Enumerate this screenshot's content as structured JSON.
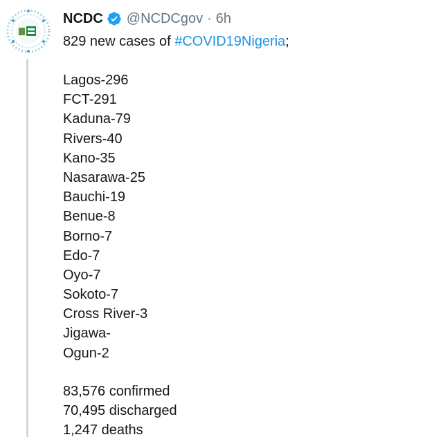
{
  "account": {
    "display_name": "NCDC",
    "handle": "@NCDCgov",
    "separator": "·",
    "time": "6h",
    "verified": true
  },
  "tweet": {
    "intro_text": "829 new cases of ",
    "hashtag": "#COVID19Nigeria",
    "intro_suffix": ";",
    "states": [
      "Lagos-296",
      "FCT-291",
      "Kaduna-79",
      "Rivers-40",
      "Kano-35",
      "Nasarawa-25",
      "Bauchi-19",
      "Benue-8",
      "Borno-7",
      "Edo-7",
      "Oyo-7",
      "Sokoto-7",
      "Cross River-3",
      "Jigawa-",
      "Ogun-2"
    ],
    "totals": [
      "83,576 confirmed",
      "70,495 discharged",
      "1,247 deaths"
    ]
  },
  "colors": {
    "text": "#14171a",
    "muted": "#657786",
    "hashtag": "#1b95e0",
    "verified": "#1da1f2",
    "thread_line": "#ccd6dd"
  },
  "icons": {
    "avatar": "ncdc-logo",
    "verified": "verified-badge-icon"
  }
}
